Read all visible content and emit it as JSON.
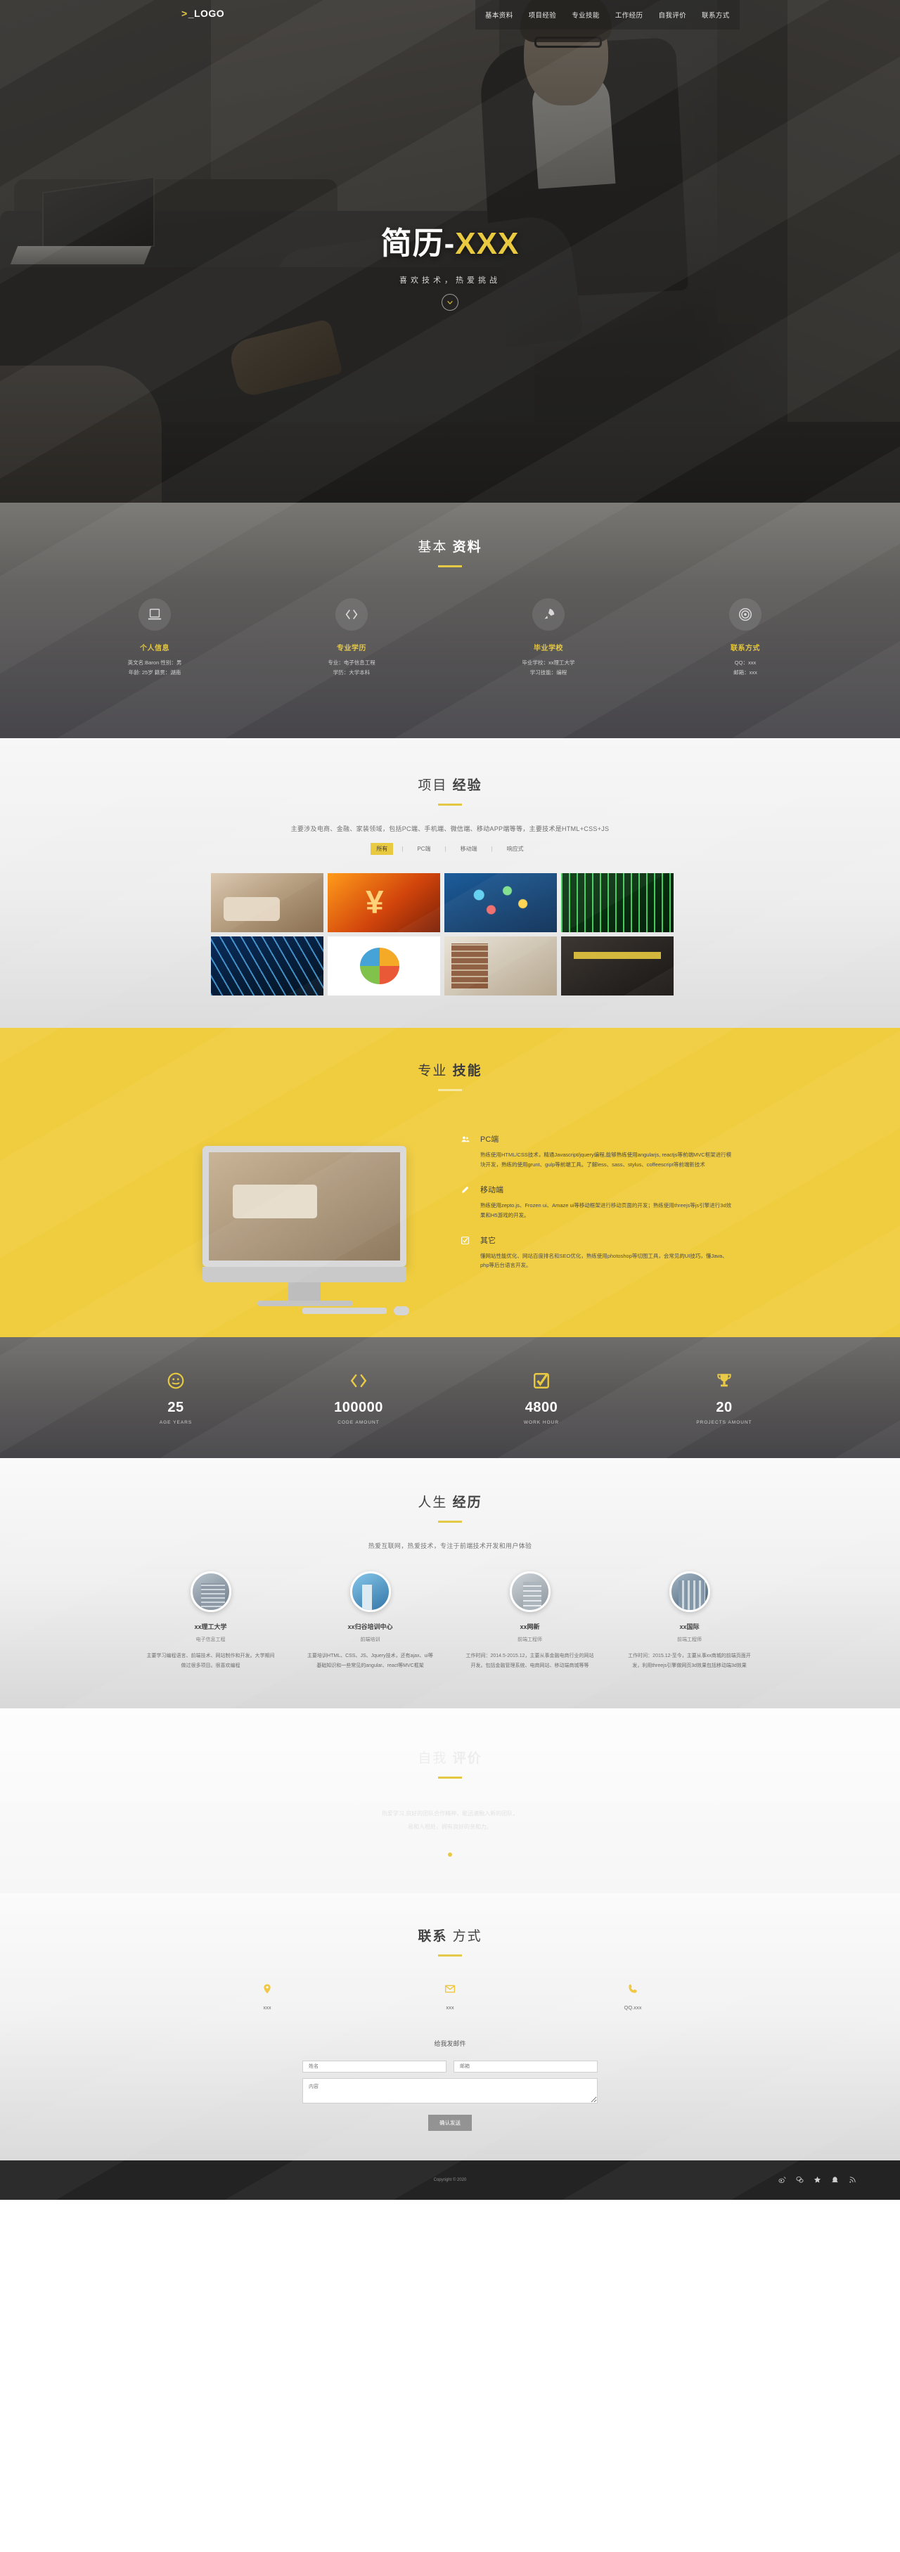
{
  "header": {
    "logo": "_LOGO",
    "nav": [
      {
        "label": "基本资料",
        "name": "nav-basic"
      },
      {
        "label": "项目经验",
        "name": "nav-projects"
      },
      {
        "label": "专业技能",
        "name": "nav-skills"
      },
      {
        "label": "工作经历",
        "name": "nav-work"
      },
      {
        "label": "自我评价",
        "name": "nav-evaluation"
      },
      {
        "label": "联系方式",
        "name": "nav-contact"
      }
    ]
  },
  "hero": {
    "title_prefix": "简历-",
    "title_accent": "XXX",
    "subtitle": "喜欢技术，热爱挑战",
    "scroll_icon": "chevron-down-icon"
  },
  "basic": {
    "title_a": "基本",
    "title_b": "资料",
    "items": [
      {
        "icon": "laptop-icon",
        "name": "个人信息",
        "line1": "英文名:Baron 性别：男",
        "line2": "年龄: 25岁 籍贯：湖南"
      },
      {
        "icon": "code-icon",
        "name": "专业学历",
        "line1": "专业：电子信息工程",
        "line2": "学历：大学本科"
      },
      {
        "icon": "rocket-icon",
        "name": "毕业学校",
        "line1": "毕业学校：xx理工大学",
        "line2": "学习技能：编程"
      },
      {
        "icon": "target-icon",
        "name": "联系方式",
        "line1": "QQ：xxx",
        "line2": "邮箱：xxx"
      }
    ]
  },
  "projects": {
    "title_a": "项目",
    "title_b": "经验",
    "desc": "主要涉及电商、金融、家装领域，包括PC端、手机端、微信端、移动APP端等等，主要技术是HTML+CSS+JS",
    "tabs": [
      {
        "label": "所有",
        "active": true
      },
      {
        "label": "PC端",
        "active": false
      },
      {
        "label": "移动端",
        "active": false
      },
      {
        "label": "响应式",
        "active": false
      }
    ],
    "separator": "|",
    "items": [
      {
        "name": "project-thumb-living-room"
      },
      {
        "name": "project-thumb-finance"
      },
      {
        "name": "project-thumb-network"
      },
      {
        "name": "project-thumb-dna-green"
      },
      {
        "name": "project-thumb-dna-blue"
      },
      {
        "name": "project-thumb-led-logo"
      },
      {
        "name": "project-thumb-office-desk"
      },
      {
        "name": "project-thumb-software"
      }
    ]
  },
  "skills": {
    "title_a": "专业",
    "title_b": "技能",
    "items": [
      {
        "icon": "users-icon",
        "heading": "PC端",
        "body": "熟练使用HTML/CSS技术，精通Javascript/jquery编程,能够熟练使用angularjs, reactjs等前端MVC框架进行模块开发，熟练的使用grunt、gulp等前端工具。了解less、sass、stylus、coffeescript等前端新技术"
      },
      {
        "icon": "pen-icon",
        "heading": "移动端",
        "body": "熟练使用zepto.js、Frozen ui、Amaze ui等移动框架进行移动页面的开发；熟练使用threejs等js引擎进行3d效果和H5游戏的开发。"
      },
      {
        "icon": "check-square-icon",
        "heading": "其它",
        "body": "懂网站性能优化、网站百度排名和SEO优化，熟练使用photoshop等切图工具，会常见的UI技巧，懂Java、php等后台语言开发。"
      }
    ]
  },
  "stats": [
    {
      "icon": "smiley-icon",
      "number": "25",
      "label": "AGE YEARS"
    },
    {
      "icon": "code-icon",
      "number": "100000",
      "label": "CODE AMOUNT"
    },
    {
      "icon": "check-box-icon",
      "number": "4800",
      "label": "WORK HOUR"
    },
    {
      "icon": "trophy-icon",
      "number": "20",
      "label": "PROJECTS AMOUNT"
    }
  ],
  "life": {
    "title_a": "人生",
    "title_b": "经历",
    "desc": "热爱互联网，热爱技术，专注于前端技术开发和用户体验",
    "items": [
      {
        "thumb": "life-thumb-university",
        "name": "xx理工大学",
        "role": "电子信息工程",
        "desc": "主要学习编程语言、前端技术、网站制作和开发。大学期间做过很多项目。很喜欢编程"
      },
      {
        "thumb": "life-thumb-training-center",
        "name": "xx归谷培训中心",
        "role": "前端培训",
        "desc": "主要培训HTML、CSS、JS、Jquery技术，还有ajax、ui等基础知识和一些常见的angular、react等MVC框架"
      },
      {
        "thumb": "life-thumb-company-wangxin",
        "name": "xx网新",
        "role": "前端工程师",
        "desc": "工作时间：2014.5-2015.12，主要从事金融电商行业的网站开发。包括金融管理系统、电商网站、移动端商城等等"
      },
      {
        "thumb": "life-thumb-company-international",
        "name": "xx国际",
        "role": "前端工程师",
        "desc": "工作时间：2015.12-至今，主要从事xx商城的前端页面开发，利用threejs引擎做网页3d效果包括移动端3d效果"
      }
    ]
  },
  "evaluation": {
    "title_a": "自我",
    "title_b": "评价",
    "line1": "热爱学习,良好的团队合作精神，能迅速融入新的团队，",
    "line2": "易和人相处，拥有良好的亲和力。"
  },
  "contact": {
    "title_a": "联系",
    "title_b": "方式",
    "items": [
      {
        "icon": "map-pin-icon",
        "value": "xxx"
      },
      {
        "icon": "envelope-icon",
        "value": "xxx"
      },
      {
        "icon": "phone-icon",
        "value": "QQ.xxx"
      }
    ],
    "form_title": "给我发邮件",
    "name_placeholder": "姓名",
    "email_placeholder": "邮箱",
    "message_placeholder": "内容",
    "submit_label": "确认发送"
  },
  "footer": {
    "copyright": "Copyright © 2020",
    "socials": [
      {
        "icon": "weibo-icon"
      },
      {
        "icon": "wechat-icon"
      },
      {
        "icon": "star-icon"
      },
      {
        "icon": "qq-icon"
      },
      {
        "icon": "rss-icon"
      }
    ]
  }
}
